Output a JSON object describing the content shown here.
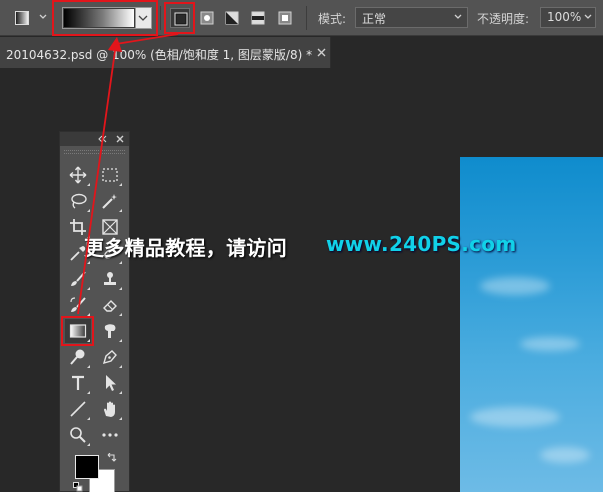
{
  "options_bar": {
    "mode_label": "模式:",
    "mode_value": "正常",
    "opacity_label": "不透明度:",
    "opacity_value": "100%",
    "gradient_types": [
      "linear",
      "radial",
      "angle",
      "reflected",
      "diamond"
    ],
    "active_gradient_type": "linear"
  },
  "document_tab": {
    "title": "20104632.psd @ 100% (色相/饱和度 1, 图层蒙版/8) *"
  },
  "toolbox": {
    "tools": [
      {
        "name": "move-tool",
        "icon": "move-icon"
      },
      {
        "name": "marquee-tool",
        "icon": "rect-marquee-icon"
      },
      {
        "name": "lasso-tool",
        "icon": "lasso-icon"
      },
      {
        "name": "magic-wand-tool",
        "icon": "magic-wand-icon"
      },
      {
        "name": "crop-tool",
        "icon": "crop-icon"
      },
      {
        "name": "frame-tool",
        "icon": "frame-icon"
      },
      {
        "name": "eyedropper-tool",
        "icon": "eyedropper-icon"
      },
      {
        "name": "healing-tool",
        "icon": "healing-icon"
      },
      {
        "name": "brush-tool",
        "icon": "brush-icon"
      },
      {
        "name": "stamp-tool",
        "icon": "stamp-icon"
      },
      {
        "name": "history-brush-tool",
        "icon": "history-brush-icon"
      },
      {
        "name": "eraser-tool",
        "icon": "eraser-icon"
      },
      {
        "name": "gradient-tool",
        "icon": "gradient-icon"
      },
      {
        "name": "smudge-tool",
        "icon": "smudge-icon"
      },
      {
        "name": "dodge-tool",
        "icon": "dodge-icon"
      },
      {
        "name": "pen-tool",
        "icon": "pen-icon"
      },
      {
        "name": "type-tool",
        "icon": "type-icon",
        "glyph": "T"
      },
      {
        "name": "path-select-tool",
        "icon": "arrow-cursor-icon"
      },
      {
        "name": "line-tool",
        "icon": "line-icon"
      },
      {
        "name": "hand-tool",
        "icon": "hand-icon"
      },
      {
        "name": "zoom-tool",
        "icon": "zoom-icon"
      },
      {
        "name": "more-tools",
        "icon": "ellipsis-icon"
      }
    ],
    "active_tool": "gradient-tool",
    "foreground_color": "#000000",
    "background_color": "#ffffff"
  },
  "watermark": {
    "text_cn": "更多精品教程，请访问",
    "text_url": "www.240PS.com"
  },
  "colors": {
    "highlight": "#e2151b",
    "url_accent": "#11d1e8"
  }
}
